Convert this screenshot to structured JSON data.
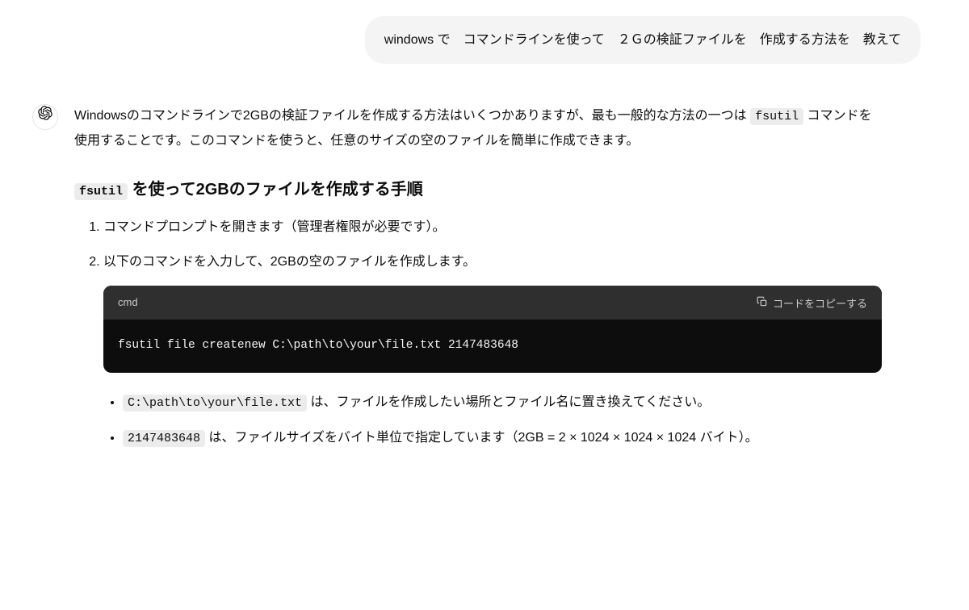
{
  "user": {
    "message": "windows で　コマンドラインを使って　２Ｇの検証ファイルを　作成する方法を　教えて"
  },
  "assistant": {
    "intro_prefix": "Windowsのコマンドラインで2GBの検証ファイルを作成する方法はいくつかありますが、最も一般的な方法の一つは ",
    "intro_code": "fsutil",
    "intro_suffix": " コマンドを使用することです。このコマンドを使うと、任意のサイズの空のファイルを簡単に作成できます。",
    "heading_code": "fsutil",
    "heading_suffix": " を使って2GBのファイルを作成する手順",
    "steps": {
      "step1": "コマンドプロンプトを開きます（管理者権限が必要です）。",
      "step2": "以下のコマンドを入力して、2GBの空のファイルを作成します。"
    },
    "code_block": {
      "lang": "cmd",
      "copy_label": "コードをコピーする",
      "content": "fsutil file createnew C:\\path\\to\\your\\file.txt 2147483648"
    },
    "bullets": {
      "b1_code": "C:\\path\\to\\your\\file.txt",
      "b1_text": " は、ファイルを作成したい場所とファイル名に置き換えてください。",
      "b2_code": "2147483648",
      "b2_text": " は、ファイルサイズをバイト単位で指定しています（2GB = 2 × 1024 × 1024 × 1024 バイト）。"
    }
  }
}
